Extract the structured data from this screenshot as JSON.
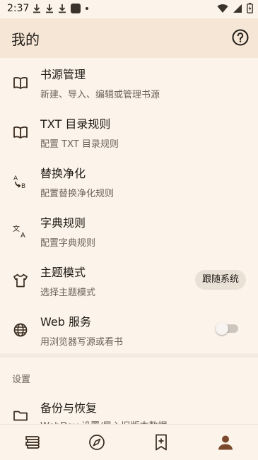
{
  "status_bar": {
    "time": "2:37",
    "left_icons": [
      "download-icon",
      "download-icon",
      "download-icon",
      "app-icon",
      "dot-icon"
    ],
    "right_icons": [
      "wifi-icon",
      "signal-icon",
      "battery-icon"
    ]
  },
  "app_bar": {
    "title": "我的",
    "help_icon": "help-circle-icon"
  },
  "items": [
    {
      "icon": "book-icon",
      "title": "书源管理",
      "subtitle": "新建、导入、编辑或管理书源"
    },
    {
      "icon": "book-icon",
      "title": "TXT 目录规则",
      "subtitle": "配置 TXT 目录规则"
    },
    {
      "icon": "replace-icon",
      "title": "替换净化",
      "subtitle": "配置替换净化规则"
    },
    {
      "icon": "translate-icon",
      "title": "字典规则",
      "subtitle": "配置字典规则"
    },
    {
      "icon": "shirt-icon",
      "title": "主题模式",
      "subtitle": "选择主题模式",
      "chip": "跟随系统"
    },
    {
      "icon": "globe-icon",
      "title": "Web 服务",
      "subtitle": "用浏览器写源或看书",
      "toggle_on": false
    }
  ],
  "settings": {
    "header": "设置",
    "backup": {
      "icon": "folder-icon",
      "title": "备份与恢复",
      "subtitle": "WebDav 设置/导入旧版本数据"
    }
  },
  "bottom_nav": {
    "items": [
      {
        "icon": "bookshelf-icon",
        "active": false
      },
      {
        "icon": "compass-icon",
        "active": false
      },
      {
        "icon": "bookmark-add-icon",
        "active": false
      },
      {
        "icon": "person-icon",
        "active": true
      }
    ]
  },
  "colors": {
    "background": "#fcf4ea",
    "app_bar": "#f6e6d6",
    "accent": "#7b4a2d",
    "chip_bg": "#e9e0d6"
  }
}
